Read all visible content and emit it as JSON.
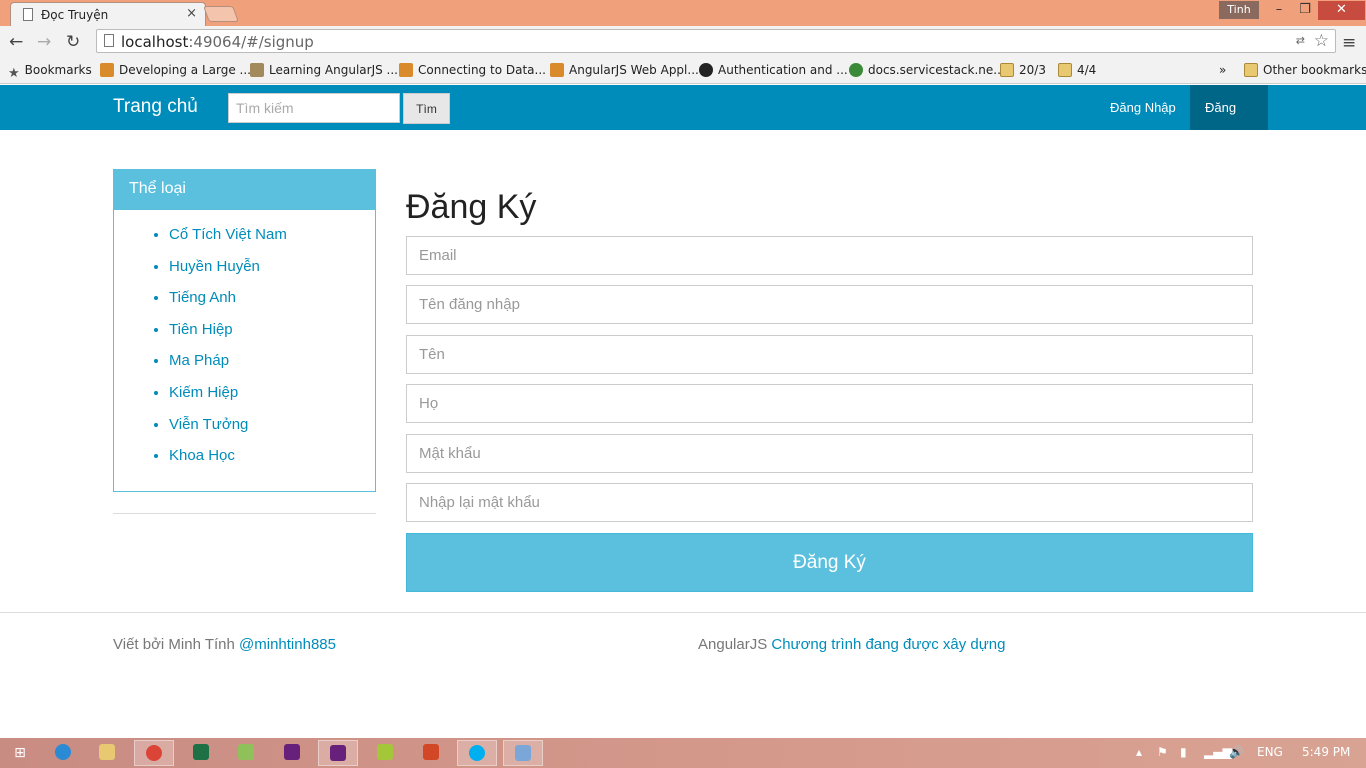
{
  "browser": {
    "tab_title": "Đọc Truyện",
    "tab_close": "×",
    "user_name": "Tinh",
    "url_host": "localhost",
    "url_path": ":49064/#/signup",
    "bookmarks": [
      {
        "label": "Bookmarks",
        "icon": "star-icon"
      },
      {
        "label": "Developing a Large ...",
        "icon": "angular-icon"
      },
      {
        "label": "Learning AngularJS ...",
        "icon": "book-icon"
      },
      {
        "label": "Connecting to Data...",
        "icon": "angular-icon"
      },
      {
        "label": "AngularJS Web Appl...",
        "icon": "angular-icon"
      },
      {
        "label": "Authentication and ...",
        "icon": "github-icon"
      },
      {
        "label": "docs.servicestack.ne...",
        "icon": "servicestack-icon"
      },
      {
        "label": "20/3",
        "icon": "folder-icon"
      },
      {
        "label": "4/4",
        "icon": "folder-icon"
      }
    ],
    "overflow": "»",
    "other_bookmarks": "Other bookmarks"
  },
  "navbar": {
    "brand": "Trang chủ",
    "search_placeholder": "Tìm kiếm",
    "search_button": "Tìm",
    "login": "Đăng Nhập",
    "signup": "Đăng Ký"
  },
  "sidebar": {
    "heading": "Thể loại",
    "categories": [
      "Cổ Tích Việt Nam",
      "Huyền Huyễn",
      "Tiếng Anh",
      "Tiên Hiệp",
      "Ma Pháp",
      "Kiếm Hiệp",
      "Viễn Tưởng",
      "Khoa Học"
    ]
  },
  "form": {
    "title": "Đăng Ký",
    "email_placeholder": "Email",
    "username_placeholder": "Tên đăng nhập",
    "firstname_placeholder": "Tên",
    "lastname_placeholder": "Họ",
    "password_placeholder": "Mật khẩu",
    "confirm_placeholder": "Nhập lại mật khẩu",
    "submit": "Đăng Ký"
  },
  "footer": {
    "left_text": "Viết bởi Minh Tính ",
    "left_link": "@minhtinh885",
    "right_text": "AngularJS ",
    "right_link": "Chương trình đang được xây dựng"
  },
  "taskbar": {
    "language": "ENG",
    "time": "5:49 PM"
  },
  "colors": {
    "navbar": "#008cba",
    "navbar_active": "#006687",
    "info": "#5bc0de",
    "link": "#008cba"
  }
}
